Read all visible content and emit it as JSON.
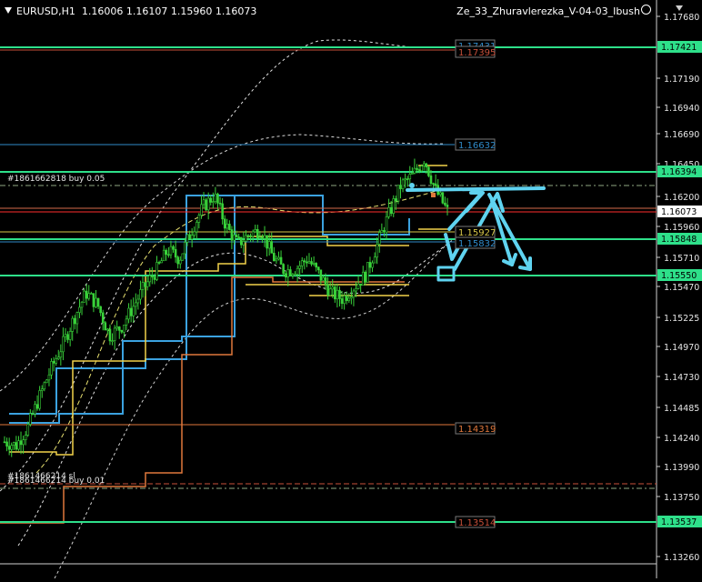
{
  "header": {
    "symbol": "EURUSD,H1",
    "ohlc": "1.16006 1.16107 1.15960 1.16073",
    "indicator": "Ze_33_Zhuravlerezka_V-04-03_Ibush"
  },
  "price_axis": {
    "ticks": [
      "1.17680",
      "1.17190",
      "1.16940",
      "1.16690",
      "1.16450",
      "1.16200",
      "1.15960",
      "1.15710",
      "1.15470",
      "1.15225",
      "1.14970",
      "1.14730",
      "1.14485",
      "1.14240",
      "1.13990",
      "1.13750",
      "1.13260"
    ]
  },
  "tags": [
    {
      "price": "1.17421",
      "type": "green"
    },
    {
      "price": "1.16394",
      "type": "green"
    },
    {
      "price": "1.16073",
      "type": "current"
    },
    {
      "price": "1.15848",
      "type": "green"
    },
    {
      "price": "1.15550",
      "type": "green"
    },
    {
      "price": "1.13537",
      "type": "green"
    }
  ],
  "inline_labels": [
    {
      "text": "1.17431",
      "color": "#2f8ac8"
    },
    {
      "text": "1.17395",
      "color": "#c7503a"
    },
    {
      "text": "1.16632",
      "color": "#2f8ac8"
    },
    {
      "text": "1.15927",
      "color": "#d9c84a"
    },
    {
      "text": "1.15832",
      "color": "#2f8ac8"
    },
    {
      "text": "1.14319",
      "color": "#e0783c"
    },
    {
      "text": "1.13514",
      "color": "#c7503a"
    }
  ],
  "orders": [
    {
      "text": "#1861662818 buy 0.05"
    },
    {
      "text": "#1861466214 sl"
    },
    {
      "text": "#1861466214 buy 0.01"
    }
  ],
  "colors": {
    "candles": "#39d23a",
    "level_green": "#2ee08a",
    "arrows": "#5fd3f0",
    "current": "#ff2e2e"
  },
  "chart_data": {
    "type": "candlestick",
    "symbol": "EURUSD",
    "timeframe": "H1",
    "ylim": [
      1.1318,
      1.178
    ],
    "last": [
      1.16006,
      1.16107,
      1.1596,
      1.16073
    ],
    "close_path": [
      1.1418,
      1.1415,
      1.143,
      1.1455,
      1.1478,
      1.1498,
      1.152,
      1.154,
      1.153,
      1.1505,
      1.1512,
      1.1528,
      1.1545,
      1.1558,
      1.1575,
      1.1568,
      1.159,
      1.161,
      1.162,
      1.1595,
      1.158,
      1.1588,
      1.1592,
      1.157,
      1.1558,
      1.156,
      1.1568,
      1.1555,
      1.154,
      1.1535,
      1.1545,
      1.1555,
      1.158,
      1.1605,
      1.1628,
      1.1636,
      1.165,
      1.1624,
      1.1607
    ]
  }
}
